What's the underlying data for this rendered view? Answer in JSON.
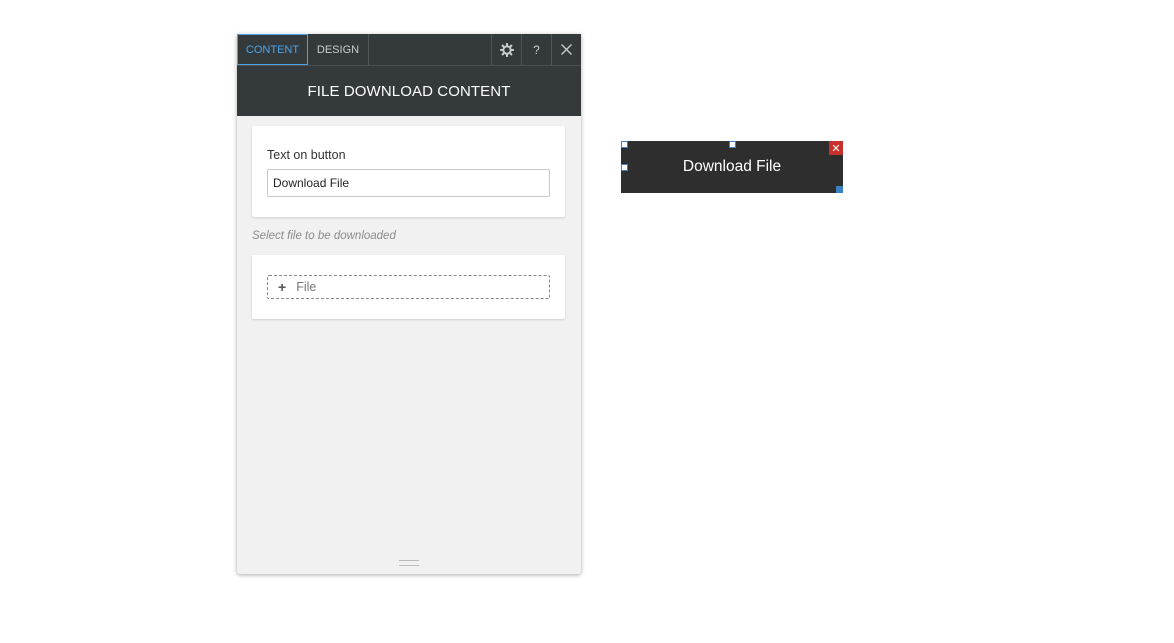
{
  "panel": {
    "tabs": [
      {
        "label": "CONTENT",
        "active": true
      },
      {
        "label": "DESIGN",
        "active": false
      }
    ],
    "icons": {
      "settings": "gear-icon",
      "help": "?",
      "close": "close-icon"
    },
    "header_title": "FILE DOWNLOAD CONTENT",
    "text_field": {
      "label": "Text on button",
      "value": "Download File"
    },
    "select_hint": "Select file to be downloaded",
    "file_button": {
      "icon": "+",
      "label": "File"
    }
  },
  "canvas": {
    "button_label": "Download File",
    "remove_icon": "✕"
  },
  "colors": {
    "panel_header": "#343a3c",
    "tab_active": "#4aa3e8",
    "button_bg": "#2e2e2e",
    "remove_bg": "#c9302c"
  }
}
